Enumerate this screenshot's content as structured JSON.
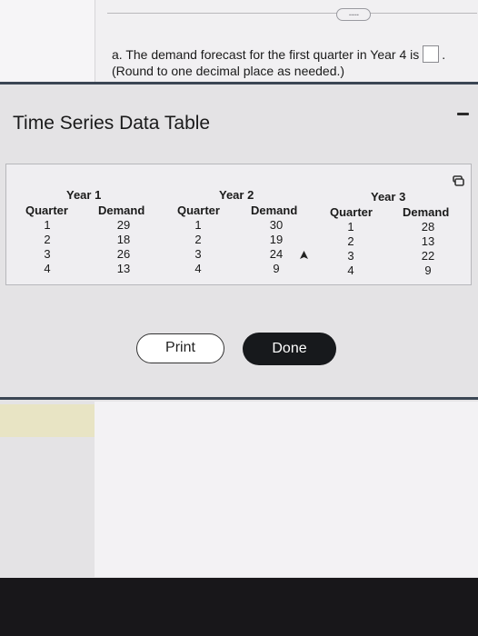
{
  "header": {
    "more_label": "....."
  },
  "question": {
    "text": "a. The demand forecast for the first quarter in Year 4 is",
    "period": ".",
    "note": "(Round to one decimal place as needed.)",
    "answer_value": ""
  },
  "modal": {
    "title": "Time Series Data Table",
    "column_labels": {
      "quarter": "Quarter",
      "demand": "Demand"
    },
    "years": [
      {
        "label": "Year 1",
        "quarters": [
          "1",
          "2",
          "3",
          "4"
        ],
        "demand": [
          "29",
          "18",
          "26",
          "13"
        ]
      },
      {
        "label": "Year 2",
        "quarters": [
          "1",
          "2",
          "3",
          "4"
        ],
        "demand": [
          "30",
          "19",
          "24",
          "9"
        ]
      },
      {
        "label": "Year 3",
        "quarters": [
          "1",
          "2",
          "3",
          "4"
        ],
        "demand": [
          "28",
          "13",
          "22",
          "9"
        ]
      }
    ],
    "buttons": {
      "print": "Print",
      "done": "Done"
    }
  },
  "colors": {
    "accent_dark": "#17191c",
    "divider": "#3b4654",
    "highlight": "#e8e4c4"
  },
  "icons": [
    "minimize-icon",
    "copy-icon",
    "cursor-icon",
    "more-icon"
  ]
}
